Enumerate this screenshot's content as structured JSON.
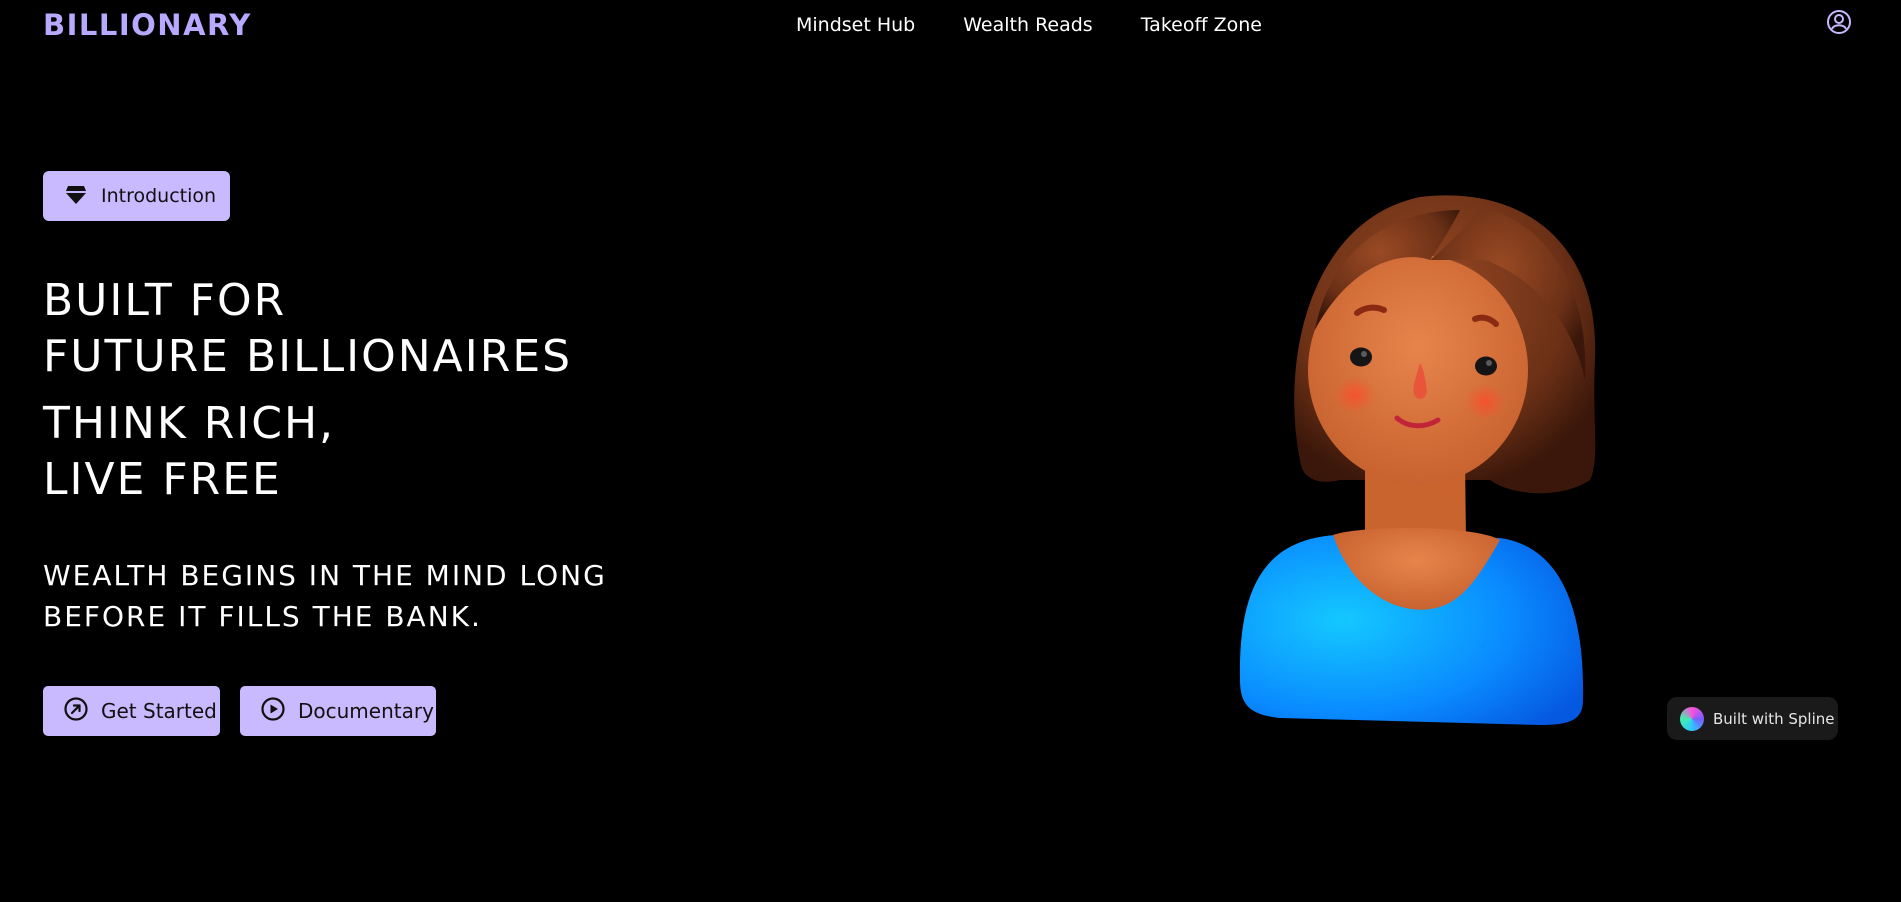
{
  "header": {
    "logo": "BILLIONARY",
    "nav": [
      "Mindset Hub",
      "Wealth Reads",
      "Takeoff Zone"
    ],
    "account_icon": "user-circle-icon"
  },
  "hero": {
    "badge": {
      "label": "Introduction",
      "icon": "diamond-icon"
    },
    "headline": [
      "BUILT FOR",
      "FUTURE BILLIONAIRES",
      "THINK RICH,",
      "LIVE FREE"
    ],
    "tagline": [
      "WEALTH BEGINS IN THE MIND LONG",
      "BEFORE IT FILLS THE BANK."
    ],
    "buttons": {
      "get_started": {
        "label": "Get Started",
        "icon": "arrow-up-right-circle-icon"
      },
      "documentary": {
        "label": "Documentary",
        "icon": "play-circle-icon"
      }
    }
  },
  "spline_badge": {
    "label": "Built with Spline"
  },
  "colors": {
    "background": "#000000",
    "accent": "#c9b9ff",
    "logo": "#b9a8ff",
    "shirt": "#0a8cff",
    "hair": "#7a3a1c",
    "skin": "#d9733f"
  }
}
